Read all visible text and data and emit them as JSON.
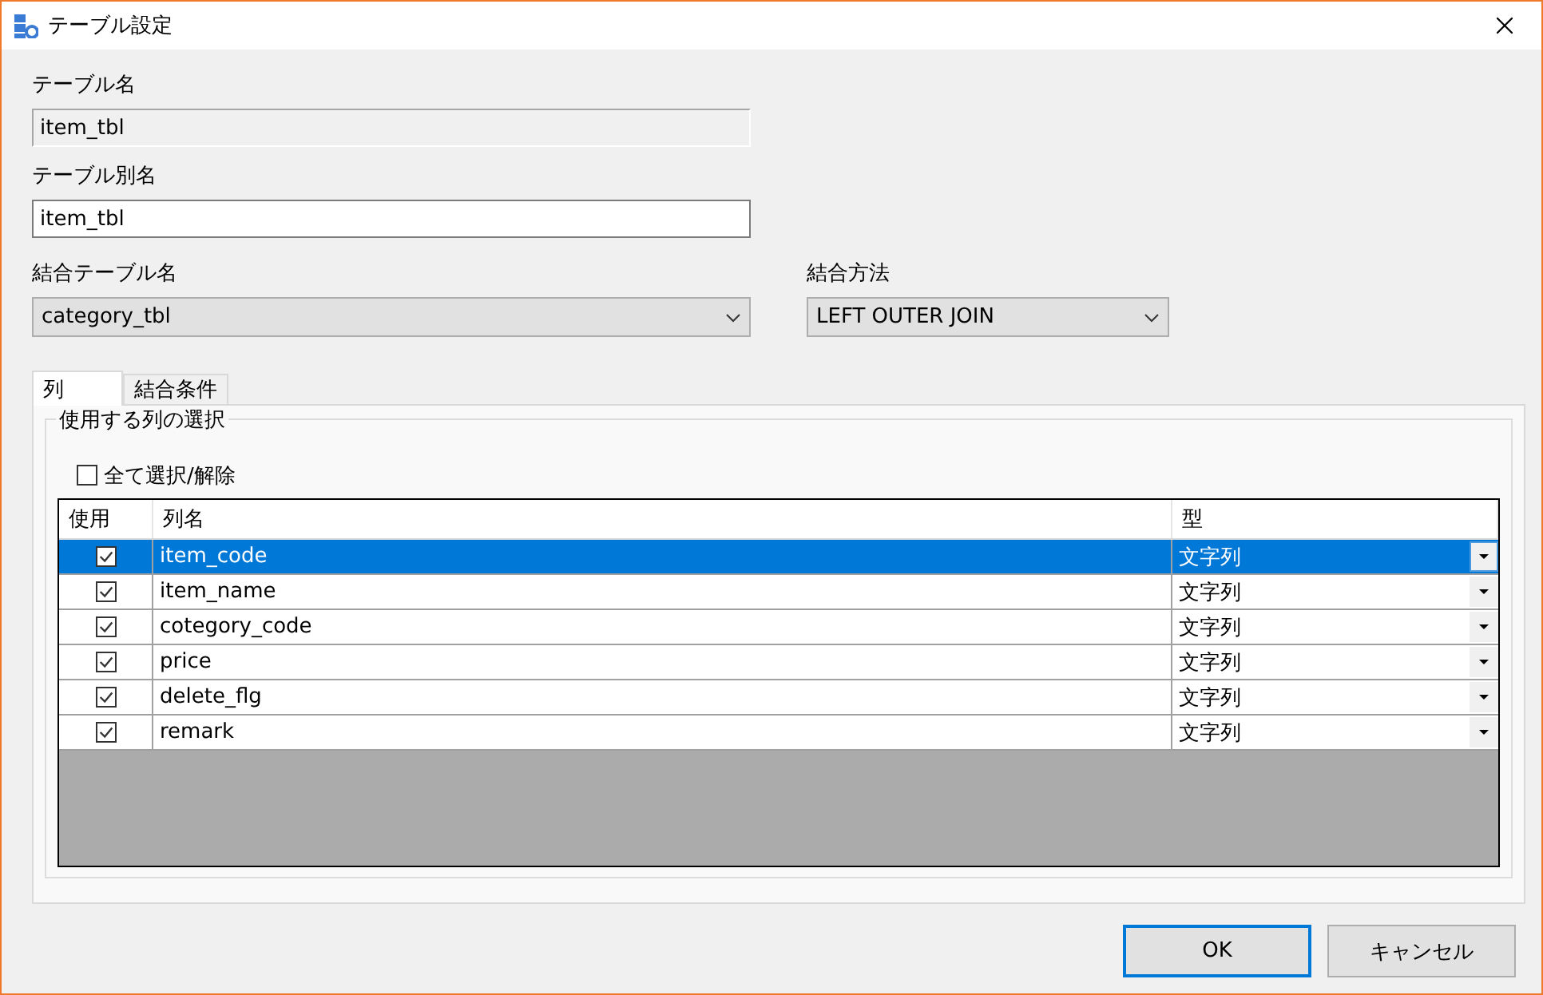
{
  "window": {
    "title": "テーブル設定"
  },
  "table_name": {
    "label": "テーブル名",
    "value": "item_tbl",
    "disabled": true
  },
  "alias": {
    "label": "テーブル別名",
    "value": "item_tbl",
    "disabled": false
  },
  "join_table": {
    "label": "結合テーブル名",
    "value": "category_tbl"
  },
  "join_method": {
    "label": "結合方法",
    "value": "LEFT OUTER JOIN"
  },
  "tabs": [
    {
      "label": "列",
      "selected": true
    },
    {
      "label": "結合条件",
      "selected": false
    }
  ],
  "group": {
    "title": "使用する列の選択",
    "select_all": {
      "label": "全て選択/解除",
      "checked": false
    }
  },
  "grid": {
    "columns": [
      "使用",
      "列名",
      "型"
    ],
    "rows": [
      {
        "use": true,
        "name": "item_code",
        "type": "文字列",
        "selected": true
      },
      {
        "use": true,
        "name": "item_name",
        "type": "文字列",
        "selected": false
      },
      {
        "use": true,
        "name": "cotegory_code",
        "type": "文字列",
        "selected": false
      },
      {
        "use": true,
        "name": "price",
        "type": "文字列",
        "selected": false
      },
      {
        "use": true,
        "name": "delete_flg",
        "type": "文字列",
        "selected": false
      },
      {
        "use": true,
        "name": "remark",
        "type": "文字列",
        "selected": false
      }
    ]
  },
  "buttons": [
    {
      "label": "OK",
      "default": true
    },
    {
      "label": "キャンセル",
      "default": false
    }
  ]
}
